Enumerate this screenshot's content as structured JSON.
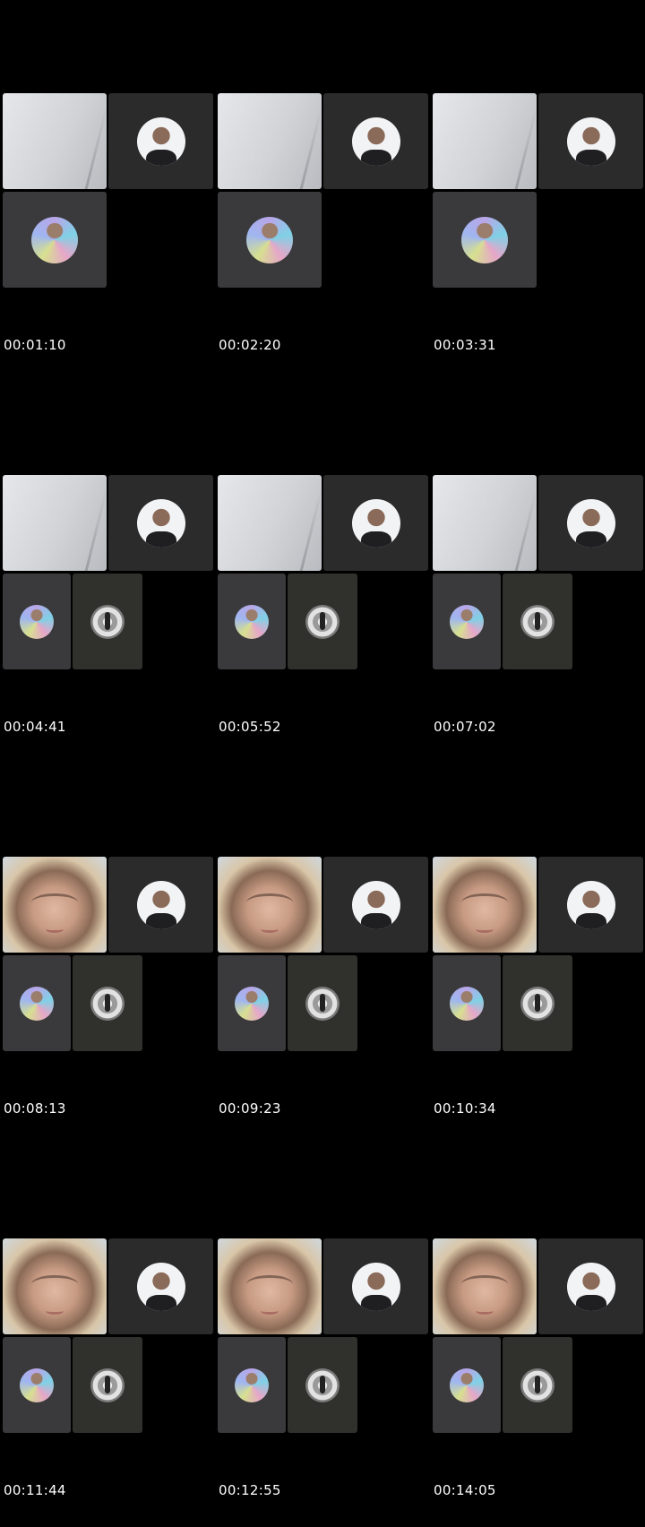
{
  "frames": [
    {
      "timestamp": "00:01:10"
    },
    {
      "timestamp": "00:02:20"
    },
    {
      "timestamp": "00:03:31"
    },
    {
      "timestamp": "00:04:41"
    },
    {
      "timestamp": "00:05:52"
    },
    {
      "timestamp": "00:07:02"
    },
    {
      "timestamp": "00:08:13"
    },
    {
      "timestamp": "00:09:23"
    },
    {
      "timestamp": "00:10:34"
    },
    {
      "timestamp": "00:11:44"
    },
    {
      "timestamp": "00:12:55"
    },
    {
      "timestamp": "00:14:05"
    }
  ],
  "colors": {
    "background": "#000000",
    "tile_gray": "#3a3a3c",
    "tile_dark": "#2b2b2b",
    "tile_olive": "#30302c",
    "timestamp_text": "#ffffff"
  },
  "icons": {
    "participant_avatar": "person-avatar-icon"
  }
}
